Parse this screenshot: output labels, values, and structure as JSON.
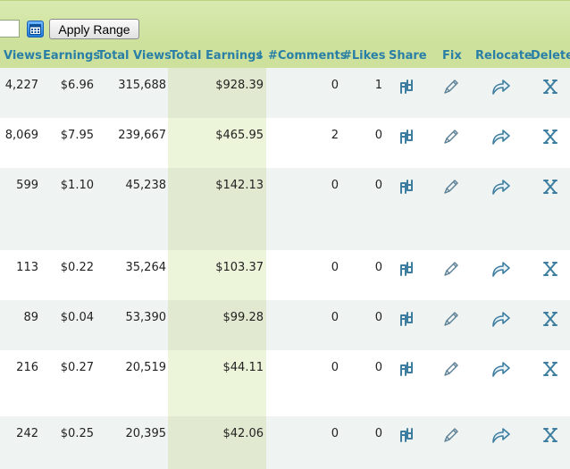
{
  "toolbar": {
    "date_value": "",
    "apply_label": "Apply Range",
    "calendar_icon": "calendar-icon"
  },
  "columns": {
    "views": "Views",
    "earnings": "Earnings",
    "total_views": "Total Views",
    "total_earnings": "Total Earnings",
    "sort_indicator": "↓",
    "comments": "#Comments",
    "likes": "#Likes",
    "share": "Share",
    "fix": "Fix",
    "relocate": "Relocate",
    "delete": "Delete"
  },
  "rows": [
    {
      "views": "4,227",
      "earnings": "$6.96",
      "total_views": "315,688",
      "total_earnings": "$928.39",
      "comments": "0",
      "likes": "1"
    },
    {
      "views": "8,069",
      "earnings": "$7.95",
      "total_views": "239,667",
      "total_earnings": "$465.95",
      "comments": "2",
      "likes": "0"
    },
    {
      "views": "599",
      "earnings": "$1.10",
      "total_views": "45,238",
      "total_earnings": "$142.13",
      "comments": "0",
      "likes": "0"
    },
    {
      "views": "113",
      "earnings": "$0.22",
      "total_views": "35,264",
      "total_earnings": "$103.37",
      "comments": "0",
      "likes": "0"
    },
    {
      "views": "89",
      "earnings": "$0.04",
      "total_views": "53,390",
      "total_earnings": "$99.28",
      "comments": "0",
      "likes": "0"
    },
    {
      "views": "216",
      "earnings": "$0.27",
      "total_views": "20,519",
      "total_earnings": "$44.11",
      "comments": "0",
      "likes": "0"
    },
    {
      "views": "242",
      "earnings": "$0.25",
      "total_views": "20,395",
      "total_earnings": "$42.06",
      "comments": "0",
      "likes": "0"
    }
  ],
  "icons": {
    "share": "share-icon",
    "fix": "pencil-icon",
    "relocate": "relocate-arrow-icon",
    "delete": "delete-x-icon"
  },
  "colors": {
    "header_text": "#2a7fa6",
    "header_bg": "#cde19c",
    "highlight_column": "#e1ead0",
    "icon": "#3d7d9f"
  }
}
